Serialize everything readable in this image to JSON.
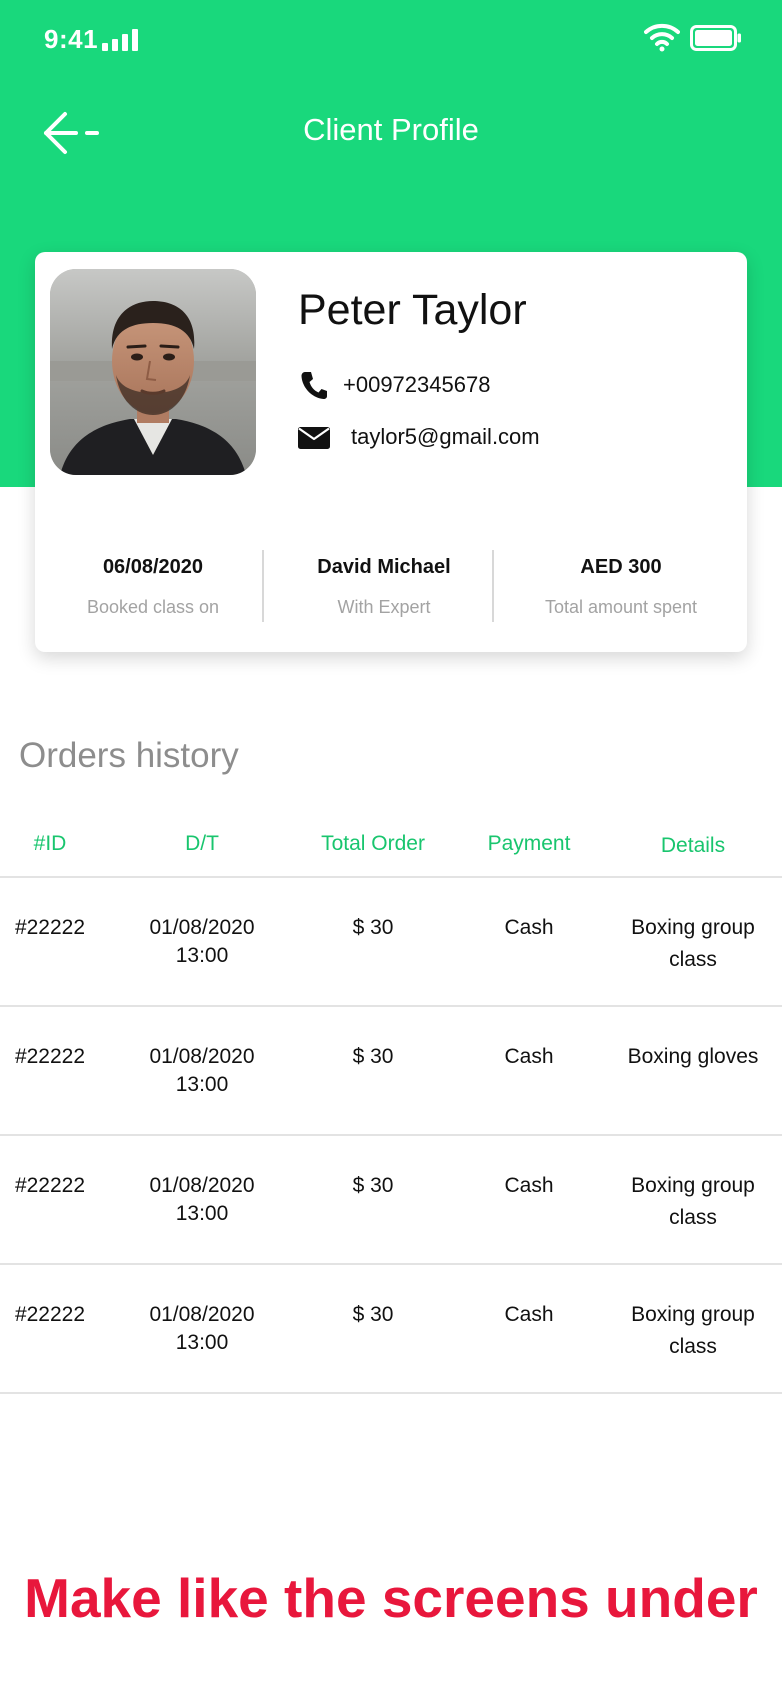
{
  "status_bar": {
    "time": "9:41"
  },
  "header": {
    "title": "Client Profile"
  },
  "client": {
    "name": "Peter Taylor",
    "phone": "+00972345678",
    "email": "taylor5@gmail.com"
  },
  "stats": [
    {
      "value": "06/08/2020",
      "label": "Booked class on"
    },
    {
      "value": "David Michael",
      "label": "With Expert"
    },
    {
      "value": "AED 300",
      "label": "Total amount spent"
    }
  ],
  "orders": {
    "title": "Orders history",
    "columns": [
      "#ID",
      "D/T",
      "Total Order",
      "Payment",
      "Details"
    ],
    "rows": [
      {
        "id": "#22222",
        "date": "01/08/2020",
        "time": "13:00",
        "total": "$ 30",
        "payment": "Cash",
        "details": "Boxing group class"
      },
      {
        "id": "#22222",
        "date": "01/08/2020",
        "time": "13:00",
        "total": "$ 30",
        "payment": "Cash",
        "details": "Boxing gloves"
      },
      {
        "id": "#22222",
        "date": "01/08/2020",
        "time": "13:00",
        "total": "$ 30",
        "payment": "Cash",
        "details": "Boxing group class"
      },
      {
        "id": "#22222",
        "date": "01/08/2020",
        "time": "13:00",
        "total": "$ 30",
        "payment": "Cash",
        "details": "Boxing group class"
      }
    ]
  },
  "footer_note": "Make like the screens under",
  "colors": {
    "brand_green": "#19d87c",
    "header_text_green": "#19c56e",
    "note_red": "#e8173c"
  }
}
